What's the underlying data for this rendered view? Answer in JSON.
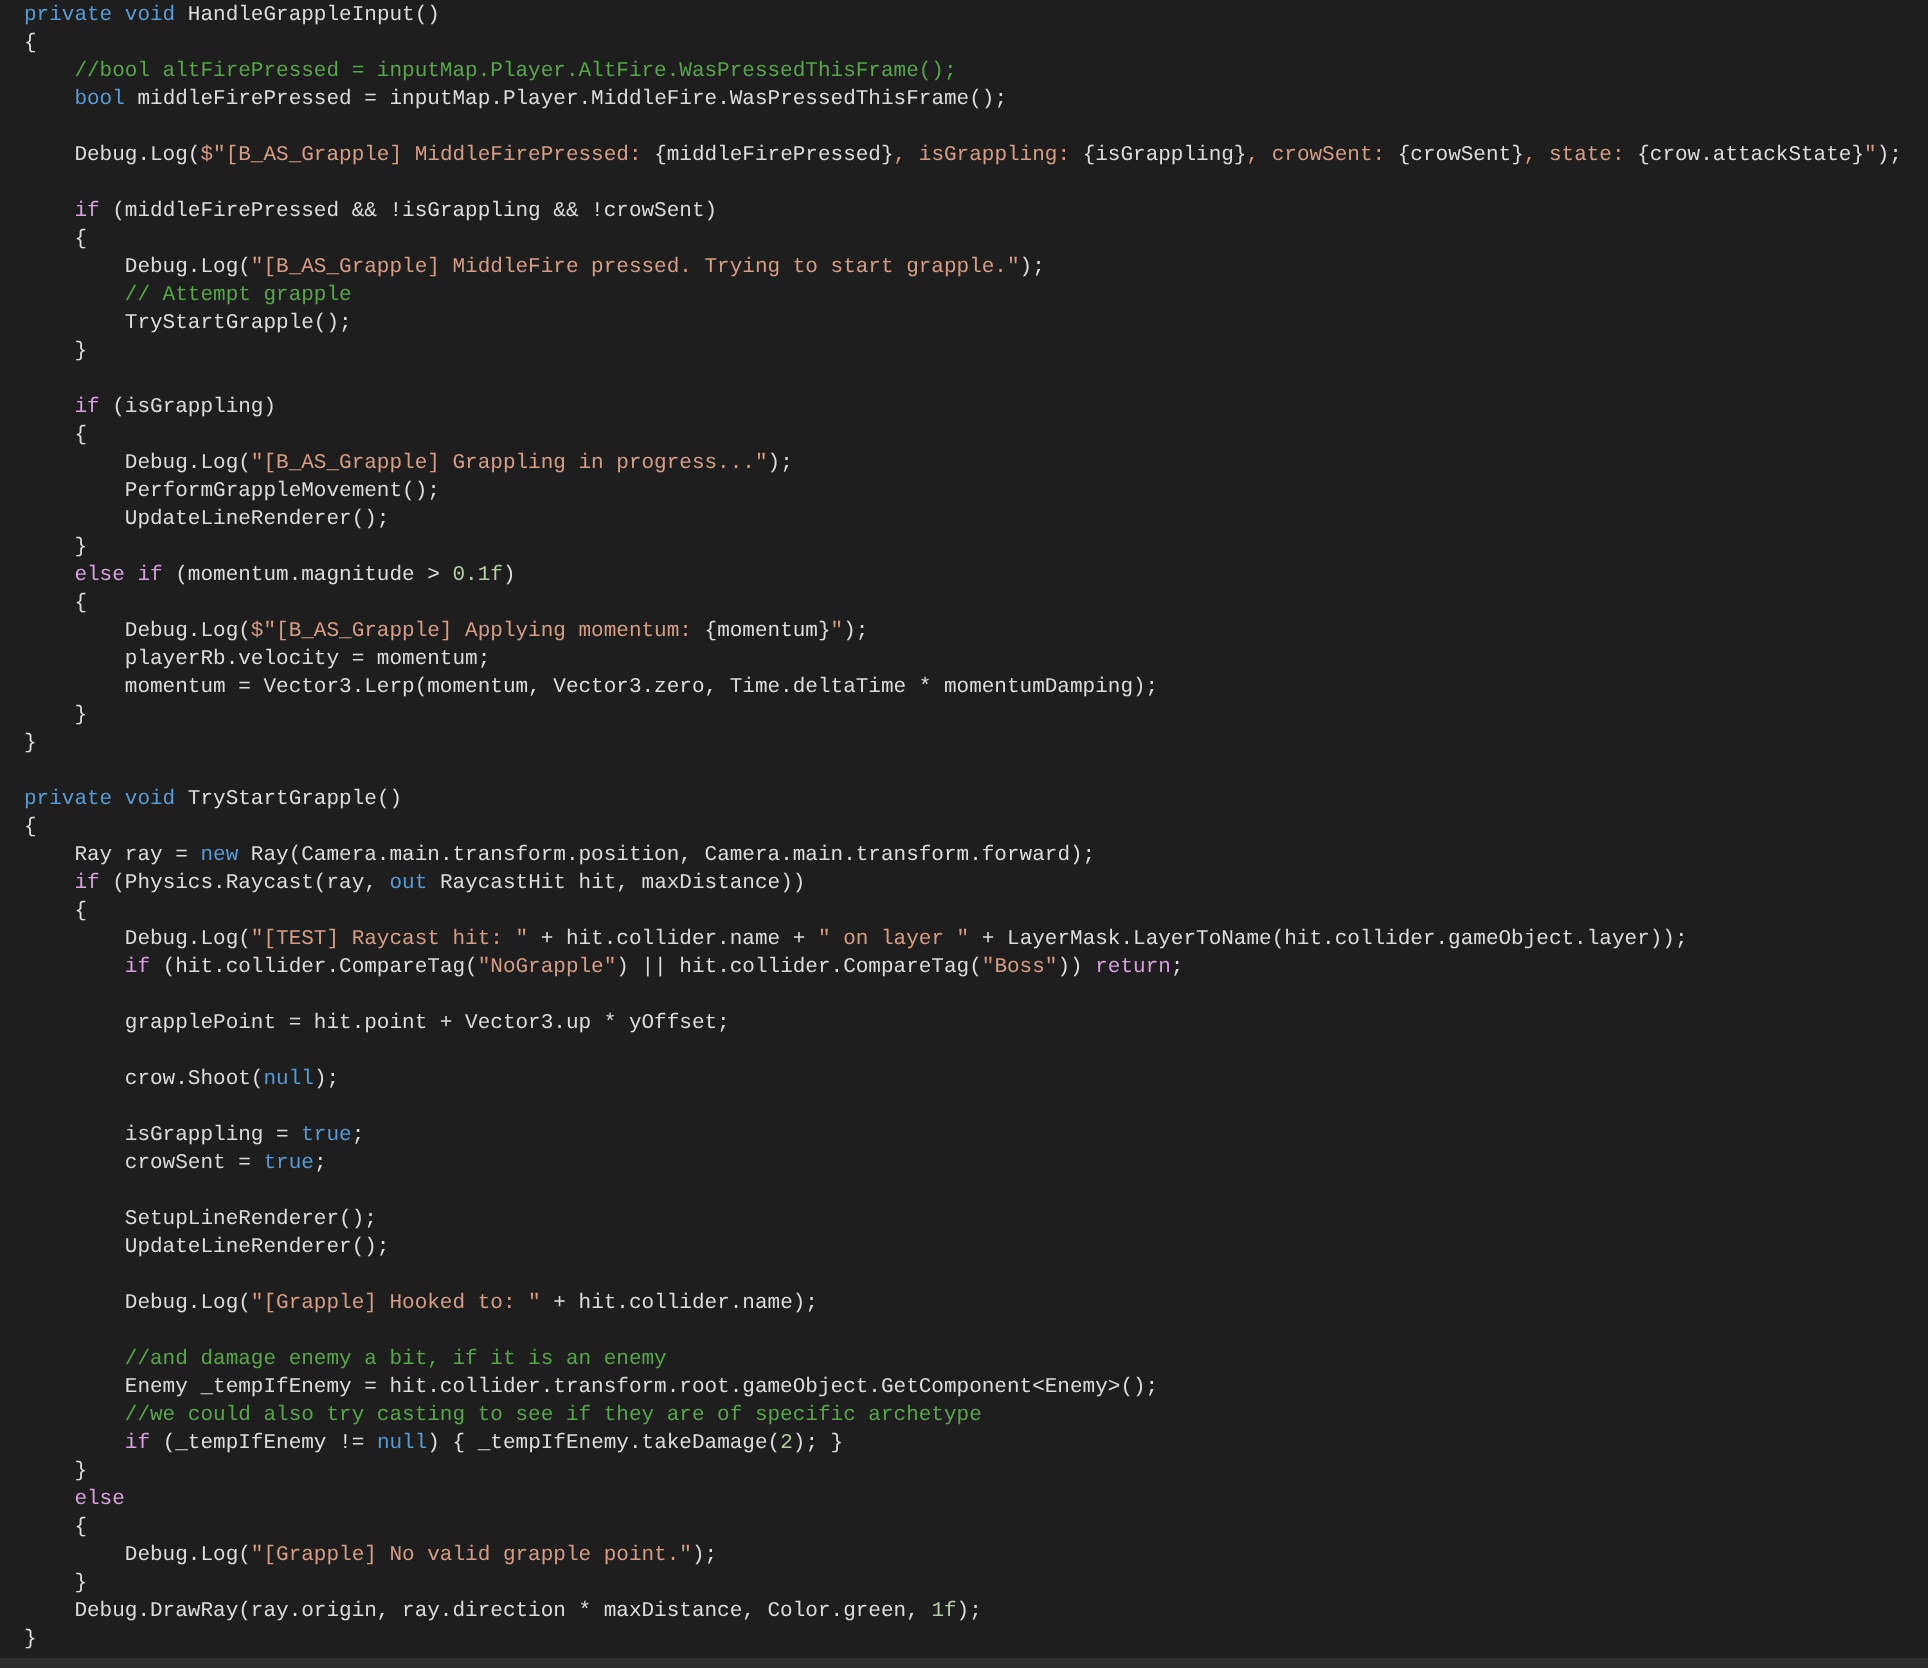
{
  "editor": {
    "blocks": [
      {
        "lines": [
          [
            {
              "kind": "kw",
              "text": "private void"
            },
            {
              "kind": "p",
              "text": " HandleGrappleInput()"
            }
          ],
          [
            {
              "kind": "p",
              "text": "{"
            }
          ],
          [
            {
              "kind": "cm",
              "text": "    //bool altFirePressed = inputMap.Player.AltFire.WasPressedThisFrame();"
            }
          ],
          [
            {
              "kind": "kw",
              "text": "    bool"
            },
            {
              "kind": "p",
              "text": " middleFirePressed = inputMap.Player.MiddleFire.WasPressedThisFrame();"
            }
          ]
        ]
      },
      {
        "lines": [
          [
            {
              "kind": "p",
              "text": "    Debug.Log("
            },
            {
              "kind": "s",
              "text": "$\"[B_AS_Grapple] MiddleFirePressed: "
            },
            {
              "kind": "p",
              "text": "{middleFirePressed}"
            },
            {
              "kind": "s",
              "text": ", isGrappling: "
            },
            {
              "kind": "p",
              "text": "{isGrappling}"
            },
            {
              "kind": "s",
              "text": ", crowSent: "
            },
            {
              "kind": "p",
              "text": "{crowSent}"
            },
            {
              "kind": "s",
              "text": ", state: "
            },
            {
              "kind": "p",
              "text": "{crow.attackState}"
            },
            {
              "kind": "s",
              "text": "\""
            },
            {
              "kind": "p",
              "text": ");"
            }
          ]
        ]
      },
      {
        "lines": [
          [
            {
              "kind": "ctl",
              "text": "    if"
            },
            {
              "kind": "p",
              "text": " (middleFirePressed && !isGrappling && !crowSent)"
            }
          ],
          [
            {
              "kind": "p",
              "text": "    {"
            }
          ],
          [
            {
              "kind": "p",
              "text": "        Debug.Log("
            },
            {
              "kind": "s",
              "text": "\"[B_AS_Grapple] MiddleFire pressed. Trying to start grapple.\""
            },
            {
              "kind": "p",
              "text": ");"
            }
          ],
          [
            {
              "kind": "cm",
              "text": "        // Attempt grapple"
            }
          ],
          [
            {
              "kind": "p",
              "text": "        TryStartGrapple();"
            }
          ],
          [
            {
              "kind": "p",
              "text": "    }"
            }
          ]
        ]
      },
      {
        "lines": [
          [
            {
              "kind": "ctl",
              "text": "    if"
            },
            {
              "kind": "p",
              "text": " (isGrappling)"
            }
          ],
          [
            {
              "kind": "p",
              "text": "    {"
            }
          ],
          [
            {
              "kind": "p",
              "text": "        Debug.Log("
            },
            {
              "kind": "s",
              "text": "\"[B_AS_Grapple] Grappling in progress...\""
            },
            {
              "kind": "p",
              "text": ");"
            }
          ],
          [
            {
              "kind": "p",
              "text": "        PerformGrappleMovement();"
            }
          ],
          [
            {
              "kind": "p",
              "text": "        UpdateLineRenderer();"
            }
          ],
          [
            {
              "kind": "p",
              "text": "    }"
            }
          ],
          [
            {
              "kind": "ctl",
              "text": "    else if"
            },
            {
              "kind": "p",
              "text": " (momentum.magnitude > "
            },
            {
              "kind": "num",
              "text": "0.1f"
            },
            {
              "kind": "p",
              "text": ")"
            }
          ],
          [
            {
              "kind": "p",
              "text": "    {"
            }
          ],
          [
            {
              "kind": "p",
              "text": "        Debug.Log("
            },
            {
              "kind": "s",
              "text": "$\"[B_AS_Grapple] Applying momentum: "
            },
            {
              "kind": "p",
              "text": "{momentum}"
            },
            {
              "kind": "s",
              "text": "\""
            },
            {
              "kind": "p",
              "text": ");"
            }
          ],
          [
            {
              "kind": "p",
              "text": "        playerRb.velocity = momentum;"
            }
          ],
          [
            {
              "kind": "p",
              "text": "        momentum = Vector3.Lerp(momentum, Vector3.zero, Time.deltaTime * momentumDamping);"
            }
          ],
          [
            {
              "kind": "p",
              "text": "    }"
            }
          ],
          [
            {
              "kind": "p",
              "text": "}"
            }
          ]
        ]
      },
      {
        "lines": [
          [
            {
              "kind": "kw",
              "text": "private void"
            },
            {
              "kind": "p",
              "text": " TryStartGrapple()"
            }
          ],
          [
            {
              "kind": "p",
              "text": "{"
            }
          ],
          [
            {
              "kind": "p",
              "text": "    Ray ray = "
            },
            {
              "kind": "kw",
              "text": "new"
            },
            {
              "kind": "p",
              "text": " Ray(Camera.main.transform.position, Camera.main.transform.forward);"
            }
          ],
          [
            {
              "kind": "ctl",
              "text": "    if"
            },
            {
              "kind": "p",
              "text": " (Physics.Raycast(ray, "
            },
            {
              "kind": "kw",
              "text": "out"
            },
            {
              "kind": "p",
              "text": " RaycastHit hit, maxDistance))"
            }
          ],
          [
            {
              "kind": "p",
              "text": "    {"
            }
          ],
          [
            {
              "kind": "p",
              "text": "        Debug.Log("
            },
            {
              "kind": "s",
              "text": "\"[TEST] Raycast hit: \""
            },
            {
              "kind": "p",
              "text": " + hit.collider.name + "
            },
            {
              "kind": "s",
              "text": "\" on layer \""
            },
            {
              "kind": "p",
              "text": " + LayerMask.LayerToName(hit.collider.gameObject.layer));"
            }
          ],
          [
            {
              "kind": "ctl",
              "text": "        if"
            },
            {
              "kind": "p",
              "text": " (hit.collider.CompareTag("
            },
            {
              "kind": "s",
              "text": "\"NoGrapple\""
            },
            {
              "kind": "p",
              "text": ") || hit.collider.CompareTag("
            },
            {
              "kind": "s",
              "text": "\"Boss\""
            },
            {
              "kind": "p",
              "text": ")) "
            },
            {
              "kind": "ctl",
              "text": "return"
            },
            {
              "kind": "p",
              "text": ";"
            }
          ]
        ]
      },
      {
        "lines": [
          [
            {
              "kind": "p",
              "text": "        grapplePoint = hit.point + Vector3.up * yOffset;"
            }
          ]
        ]
      },
      {
        "lines": [
          [
            {
              "kind": "p",
              "text": "        crow.Shoot("
            },
            {
              "kind": "kw",
              "text": "null"
            },
            {
              "kind": "p",
              "text": ");"
            }
          ]
        ]
      },
      {
        "lines": [
          [
            {
              "kind": "p",
              "text": "        isGrappling = "
            },
            {
              "kind": "kw",
              "text": "true"
            },
            {
              "kind": "p",
              "text": ";"
            }
          ],
          [
            {
              "kind": "p",
              "text": "        crowSent = "
            },
            {
              "kind": "kw",
              "text": "true"
            },
            {
              "kind": "p",
              "text": ";"
            }
          ]
        ]
      },
      {
        "lines": [
          [
            {
              "kind": "p",
              "text": "        SetupLineRenderer();"
            }
          ],
          [
            {
              "kind": "p",
              "text": "        UpdateLineRenderer();"
            }
          ]
        ]
      },
      {
        "lines": [
          [
            {
              "kind": "p",
              "text": "        Debug.Log("
            },
            {
              "kind": "s",
              "text": "\"[Grapple] Hooked to: \""
            },
            {
              "kind": "p",
              "text": " + hit.collider.name);"
            }
          ]
        ]
      },
      {
        "lines": [
          [
            {
              "kind": "cm",
              "text": "        //and damage enemy a bit, if it is an enemy"
            }
          ],
          [
            {
              "kind": "p",
              "text": "        Enemy _tempIfEnemy = hit.collider.transform.root.gameObject.GetComponent<Enemy>();"
            }
          ],
          [
            {
              "kind": "cm",
              "text": "        //we could also try casting to see if they are of specific archetype"
            }
          ],
          [
            {
              "kind": "ctl",
              "text": "        if"
            },
            {
              "kind": "p",
              "text": " (_tempIfEnemy != "
            },
            {
              "kind": "kw",
              "text": "null"
            },
            {
              "kind": "p",
              "text": ") { _tempIfEnemy.takeDamage("
            },
            {
              "kind": "num",
              "text": "2"
            },
            {
              "kind": "p",
              "text": "); }"
            }
          ],
          [
            {
              "kind": "p",
              "text": "    }"
            }
          ],
          [
            {
              "kind": "ctl",
              "text": "    else"
            }
          ],
          [
            {
              "kind": "p",
              "text": "    {"
            }
          ],
          [
            {
              "kind": "p",
              "text": "        Debug.Log("
            },
            {
              "kind": "s",
              "text": "\"[Grapple] No valid grapple point.\""
            },
            {
              "kind": "p",
              "text": ");"
            }
          ],
          [
            {
              "kind": "p",
              "text": "    }"
            }
          ],
          [
            {
              "kind": "p",
              "text": "    Debug.DrawRay(ray.origin, ray.direction * maxDistance, Color.green, "
            },
            {
              "kind": "num",
              "text": "1f"
            },
            {
              "kind": "p",
              "text": ");"
            }
          ],
          [
            {
              "kind": "p",
              "text": "}"
            }
          ]
        ]
      }
    ]
  }
}
